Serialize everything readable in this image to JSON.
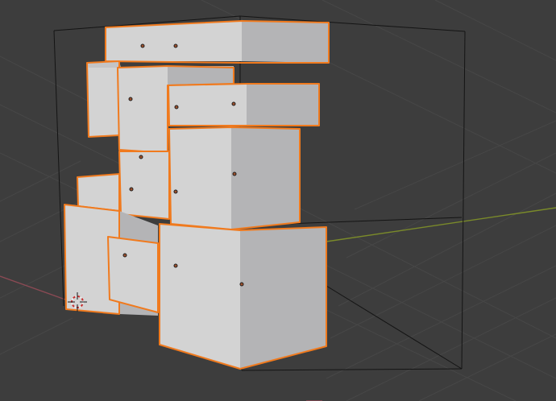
{
  "viewport": {
    "background": "#3d3d3d",
    "grid_color": "#474747",
    "x_axis_color": "#8b4a54",
    "y_axis_color": "#7a8a2a",
    "selection_color": "#f07a1e",
    "bounds_color": "#141414"
  },
  "scene": {
    "selected_object_count": 11,
    "icons": {
      "cursor": "3d-cursor-icon",
      "origin": "object-origin-icon"
    }
  }
}
